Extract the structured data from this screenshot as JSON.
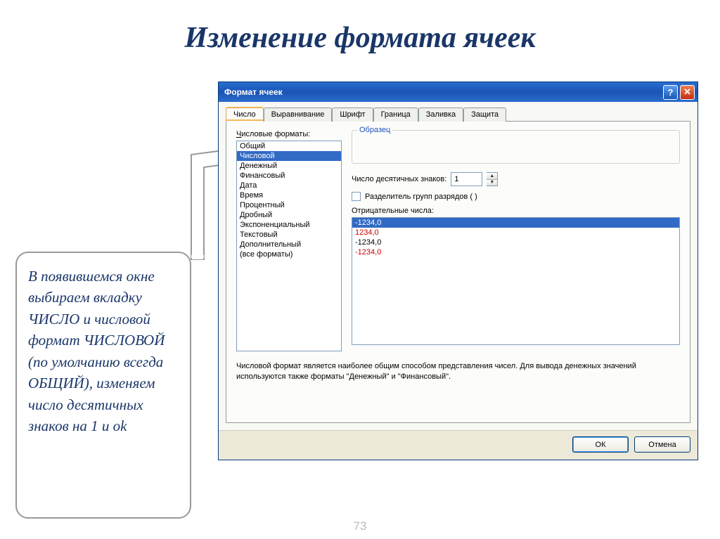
{
  "slide": {
    "title": "Изменение формата ячеек",
    "page_number": "73"
  },
  "callout": {
    "text": "В появившемся окне выбираем вкладку  ЧИСЛО и числовой формат ЧИСЛОВОЙ (по умолчанию всегда ОБЩИЙ),  изменяем число десятичных знаков на 1 и ok"
  },
  "dialog": {
    "title": "Формат ячеек",
    "help_icon": "?",
    "close_icon": "✕",
    "tabs": [
      "Число",
      "Выравнивание",
      "Шрифт",
      "Граница",
      "Заливка",
      "Защита"
    ],
    "formats_label": "Числовые форматы:",
    "formats": [
      "Общий",
      "Числовой",
      "Денежный",
      "Финансовый",
      "Дата",
      "Время",
      "Процентный",
      "Дробный",
      "Экспоненциальный",
      "Текстовый",
      "Дополнительный",
      "(все форматы)"
    ],
    "selected_format": "Числовой",
    "sample_label": "Образец",
    "decimal_label": "Число десятичных знаков:",
    "decimal_value": "1",
    "separator_label": "Разделитель групп разрядов ( )",
    "negative_label": "Отрицательные числа:",
    "negatives": [
      {
        "text": "-1234,0",
        "red": false,
        "selected": true
      },
      {
        "text": "1234,0",
        "red": true,
        "selected": false
      },
      {
        "text": "-1234,0",
        "red": false,
        "selected": false
      },
      {
        "text": "-1234,0",
        "red": true,
        "selected": false
      }
    ],
    "description": "Числовой формат является наиболее общим способом представления чисел. Для вывода денежных значений используются также форматы \"Денежный\" и \"Финансовый\".",
    "ok_label": "ОК",
    "cancel_label": "Отмена"
  }
}
